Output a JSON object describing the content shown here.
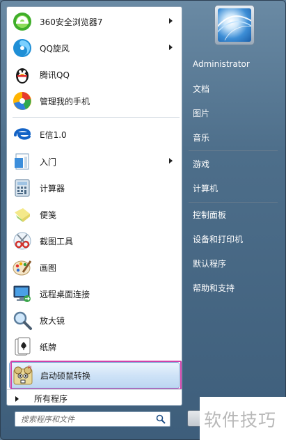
{
  "programs": [
    {
      "label": "360安全浏览器7",
      "icon": "browser-360-icon",
      "arrow": true
    },
    {
      "label": "QQ旋风",
      "icon": "qq-whirlwind-icon",
      "arrow": true
    },
    {
      "label": "腾讯QQ",
      "icon": "qq-penguin-icon",
      "arrow": false
    },
    {
      "label": "管理我的手机",
      "icon": "phone-manager-icon",
      "arrow": false
    },
    {
      "label": "E信1.0",
      "icon": "telecom-e-icon",
      "arrow": false
    },
    {
      "label": "入门",
      "icon": "getting-started-icon",
      "arrow": true
    },
    {
      "label": "计算器",
      "icon": "calculator-icon",
      "arrow": false
    },
    {
      "label": "便笺",
      "icon": "sticky-notes-icon",
      "arrow": false
    },
    {
      "label": "截图工具",
      "icon": "snipping-tool-icon",
      "arrow": false
    },
    {
      "label": "画图",
      "icon": "paint-icon",
      "arrow": false
    },
    {
      "label": "远程桌面连接",
      "icon": "remote-desktop-icon",
      "arrow": false
    },
    {
      "label": "放大镜",
      "icon": "magnifier-icon",
      "arrow": false
    },
    {
      "label": "纸牌",
      "icon": "solitaire-icon",
      "arrow": false
    },
    {
      "label": "启动硕鼠转换",
      "icon": "shuoshu-convert-icon",
      "arrow": false
    }
  ],
  "all_programs": "所有程序",
  "search": {
    "placeholder": "搜索程序和文件"
  },
  "right": {
    "user": "Administrator",
    "documents": "文档",
    "pictures": "图片",
    "music": "音乐",
    "games": "游戏",
    "computer": "计算机",
    "control_panel": "控制面板",
    "devices": "设备和打印机",
    "default_programs": "默认程序",
    "help": "帮助和支持"
  },
  "watermark": "软件技巧"
}
